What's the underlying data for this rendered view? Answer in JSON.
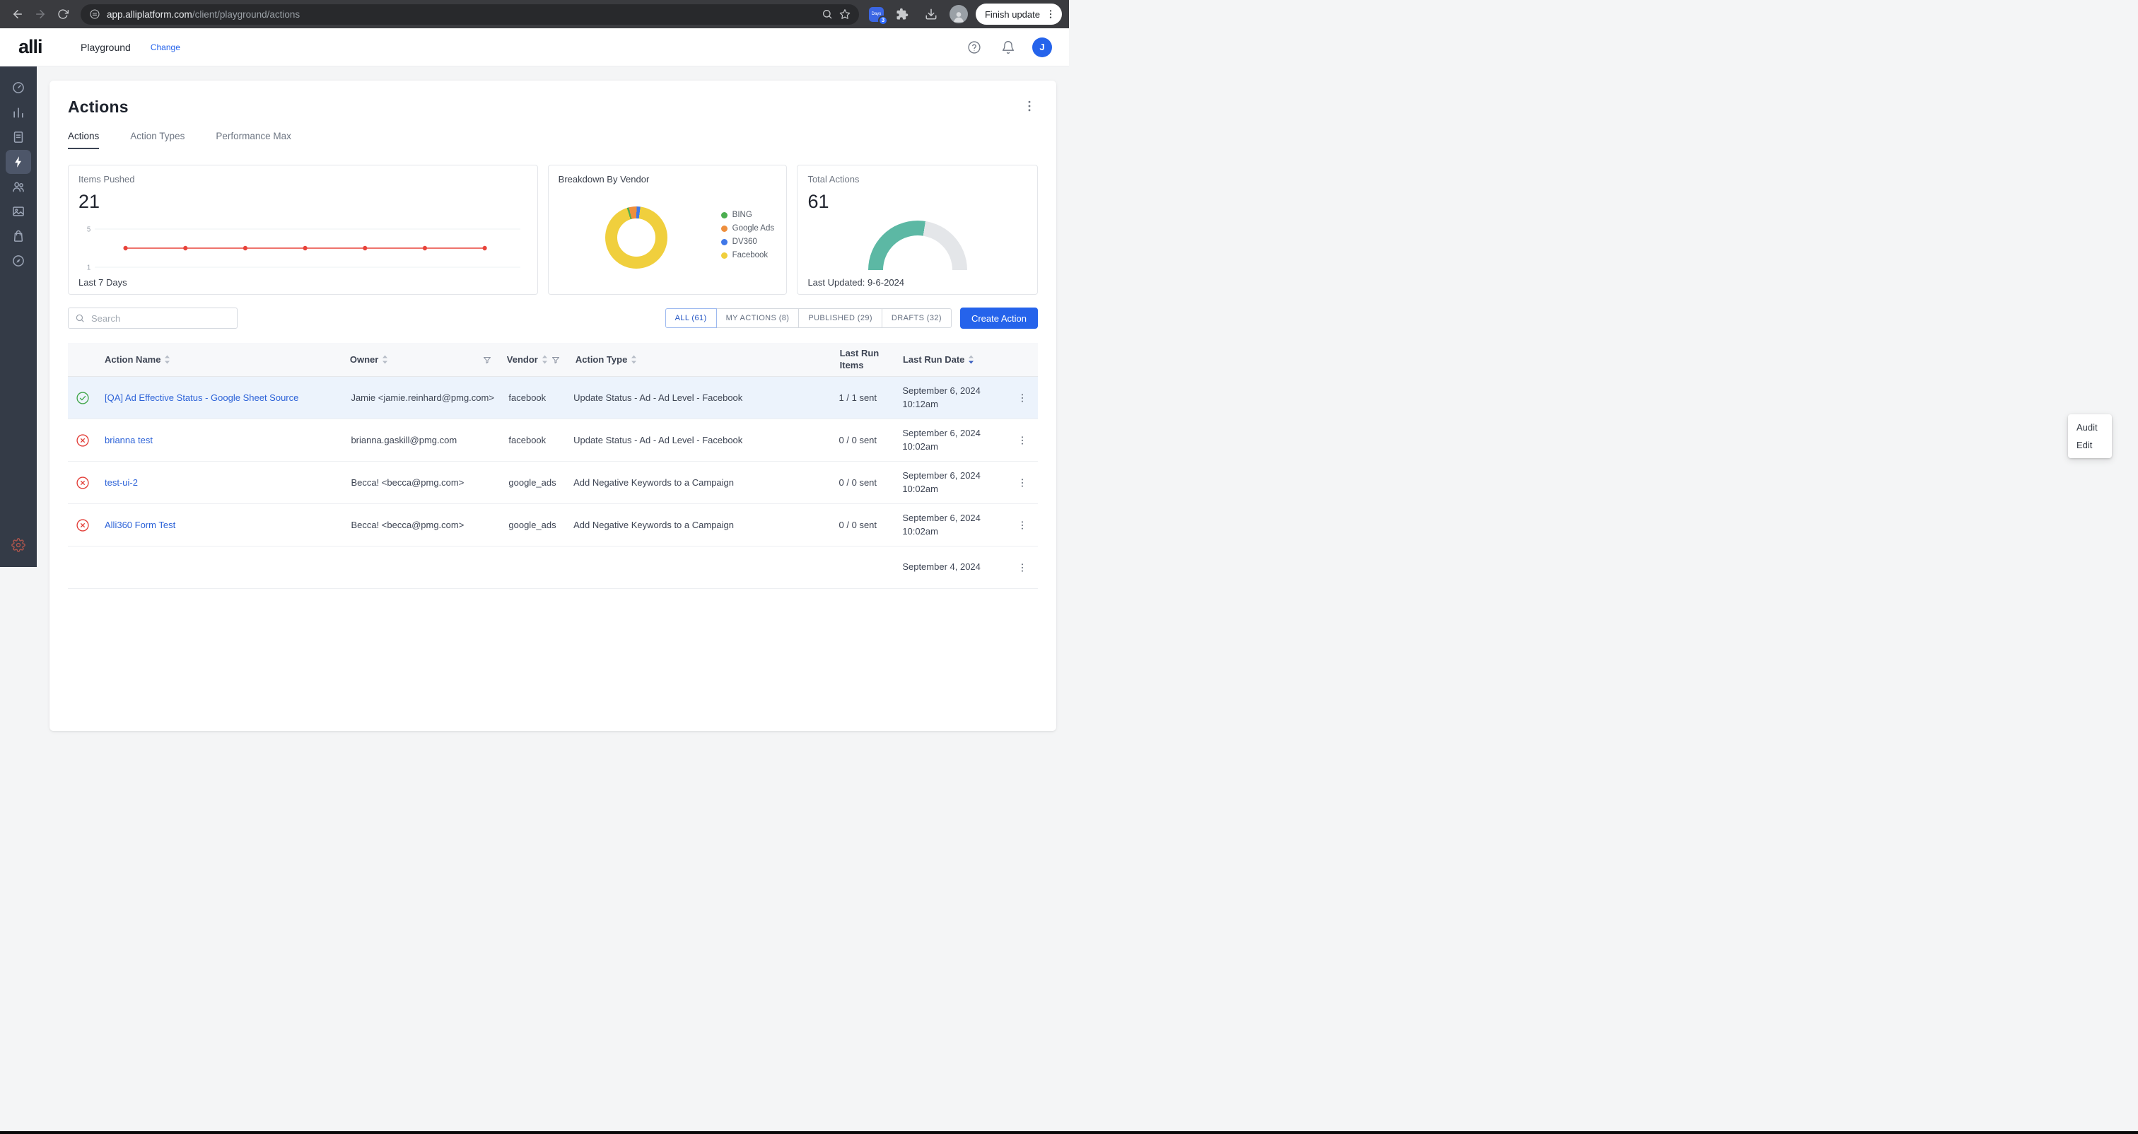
{
  "colors": {
    "accent_blue": "#2563eb",
    "link_blue": "#2d63d8",
    "success_green": "#3fa548",
    "error_red": "#e23b35",
    "chart_line_red": "#e8453c",
    "gauge_teal": "#5cb8a4",
    "sidebar_bg": "#343b47"
  },
  "browser": {
    "url_domain": "app.alliplatform.com",
    "url_path": "/client/playground/actions",
    "extension_badge_label": "Days",
    "extension_badge_count": "3",
    "update_button_label": "Finish update"
  },
  "header": {
    "logo_text": "alli",
    "workspace_name": "Playground",
    "change_link_label": "Change",
    "user_initial": "J"
  },
  "sidebar": {
    "items": [
      {
        "name": "dashboard"
      },
      {
        "name": "analytics"
      },
      {
        "name": "reports"
      },
      {
        "name": "actions",
        "active": true
      },
      {
        "name": "audiences"
      },
      {
        "name": "creative"
      },
      {
        "name": "shopping"
      },
      {
        "name": "explore"
      }
    ],
    "bottom_item": {
      "name": "settings"
    }
  },
  "page": {
    "title": "Actions",
    "tabs": [
      {
        "label": "Actions",
        "active": true
      },
      {
        "label": "Action Types",
        "active": false
      },
      {
        "label": "Performance Max",
        "active": false
      }
    ]
  },
  "stat_cards": {
    "items_pushed": {
      "label": "Items Pushed",
      "value": "21",
      "footer": "Last 7 Days"
    },
    "vendor_breakdown": {
      "title": "Breakdown By Vendor",
      "legend": [
        {
          "label": "BING",
          "color": "#4cae50"
        },
        {
          "label": "Google Ads",
          "color": "#ee8f3d"
        },
        {
          "label": "DV360",
          "color": "#4078e8"
        },
        {
          "label": "Facebook",
          "color": "#f0cf3d"
        }
      ]
    },
    "total_actions": {
      "label": "Total Actions",
      "value": "61",
      "footer": "Last Updated: 9-6-2024"
    }
  },
  "chart_data": [
    {
      "id": "items-pushed-trend",
      "type": "line",
      "title": "Items Pushed - Last 7 Days",
      "values": [
        3,
        3,
        3,
        3,
        3,
        3,
        3
      ],
      "ylim": [
        1,
        5
      ],
      "y_ticks": [
        5,
        1
      ],
      "line_color": "#e8453c",
      "grid": true,
      "note": "flat line, 7 daily points, 21 items total"
    },
    {
      "id": "vendor-breakdown-donut",
      "type": "donut",
      "title": "Breakdown By Vendor",
      "start_angle": -14,
      "slices": [
        {
          "label": "Google Ads",
          "percent": 4,
          "color": "#ee8f3d"
        },
        {
          "label": "DV360",
          "percent": 2,
          "color": "#4078e8"
        },
        {
          "label": "Facebook",
          "percent": 93,
          "color": "#f0cf3d"
        },
        {
          "label": "BING",
          "percent": 1,
          "color": "#4cae50"
        }
      ],
      "legend_position": "right"
    },
    {
      "id": "total-actions-gauge",
      "type": "gauge",
      "title": "Total Actions",
      "percent": 55,
      "color": "#5cb8a4",
      "track_color": "#e4e6e9"
    }
  ],
  "toolbar": {
    "search_placeholder": "Search",
    "filters": [
      {
        "label": "ALL (61)",
        "active": true
      },
      {
        "label": "MY ACTIONS (8)",
        "active": false
      },
      {
        "label": "PUBLISHED (29)",
        "active": false
      },
      {
        "label": "DRAFTS (32)",
        "active": false
      }
    ],
    "create_button_label": "Create Action"
  },
  "table": {
    "headers": {
      "action_name": "Action Name",
      "owner": "Owner",
      "vendor": "Vendor",
      "action_type": "Action Type",
      "last_run_items_line1": "Last Run",
      "last_run_items_line2": "Items",
      "last_run_date": "Last Run Date"
    },
    "rows": [
      {
        "status": "success",
        "name": "[QA] Ad Effective Status - Google Sheet Source",
        "owner": "Jamie <jamie.reinhard@pmg.com>",
        "vendor": "facebook",
        "action_type": "Update Status - Ad - Ad Level - Facebook",
        "items": "1 / 1 sent",
        "date": "September 6, 2024",
        "time": "10:12am"
      },
      {
        "status": "error",
        "name": "brianna test",
        "owner": "brianna.gaskill@pmg.com",
        "vendor": "facebook",
        "action_type": "Update Status - Ad - Ad Level - Facebook",
        "items": "0 / 0 sent",
        "date": "September 6, 2024",
        "time": "10:02am"
      },
      {
        "status": "error",
        "name": "test-ui-2",
        "owner": "Becca! <becca@pmg.com>",
        "vendor": "google_ads",
        "action_type": "Add Negative Keywords to a Campaign",
        "items": "0 / 0 sent",
        "date": "September 6, 2024",
        "time": "10:02am"
      },
      {
        "status": "error",
        "name": "Alli360 Form Test",
        "owner": "Becca! <becca@pmg.com>",
        "vendor": "google_ads",
        "action_type": "Add Negative Keywords to a Campaign",
        "items": "0 / 0 sent",
        "date": "September 6, 2024",
        "time": "10:02am"
      },
      {
        "status": "",
        "name": "",
        "owner": "",
        "vendor": "",
        "action_type": "",
        "items": "",
        "date": "September 4, 2024",
        "time": ""
      }
    ]
  },
  "context_menu": {
    "items": [
      {
        "label": "Audit"
      },
      {
        "label": "Edit"
      }
    ]
  }
}
